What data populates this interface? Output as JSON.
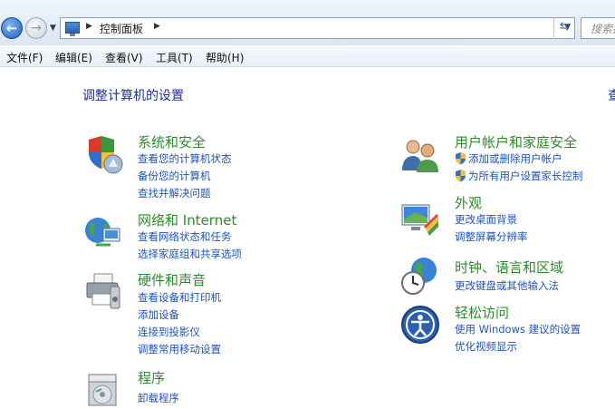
{
  "address_bar": {
    "path": "控制面板",
    "search_placeholder": "搜索控"
  },
  "menu": [
    "文件(F)",
    "编辑(E)",
    "查看(V)",
    "工具(T)",
    "帮助(H)"
  ],
  "page_title": "调整计算机的设置",
  "right_cut_text": "查",
  "categories": {
    "system_security": {
      "title": "系统和安全",
      "links": [
        "查看您的计算机状态",
        "备份您的计算机",
        "查找并解决问题"
      ]
    },
    "network": {
      "title": "网络和 Internet",
      "links": [
        "查看网络状态和任务",
        "选择家庭组和共享选项"
      ]
    },
    "hardware": {
      "title": "硬件和声音",
      "links": [
        "查看设备和打印机",
        "添加设备",
        "连接到投影仪",
        "调整常用移动设置"
      ]
    },
    "programs": {
      "title": "程序",
      "links": [
        "卸载程序"
      ]
    },
    "user_accounts": {
      "title": "用户帐户和家庭安全",
      "links": [
        "添加或删除用户帐户",
        "为所有用户设置家长控制"
      ]
    },
    "appearance": {
      "title": "外观",
      "links": [
        "更改桌面背景",
        "调整屏幕分辨率"
      ]
    },
    "clock": {
      "title": "时钟、语言和区域",
      "links": [
        "更改键盘或其他输入法"
      ]
    },
    "ease": {
      "title": "轻松访问",
      "links": [
        "使用 Windows 建议的设置",
        "优化视频显示"
      ]
    }
  },
  "colors": {
    "category_title": "#2e8a2e",
    "link": "#1f54b6",
    "page_title": "#1e3287"
  }
}
